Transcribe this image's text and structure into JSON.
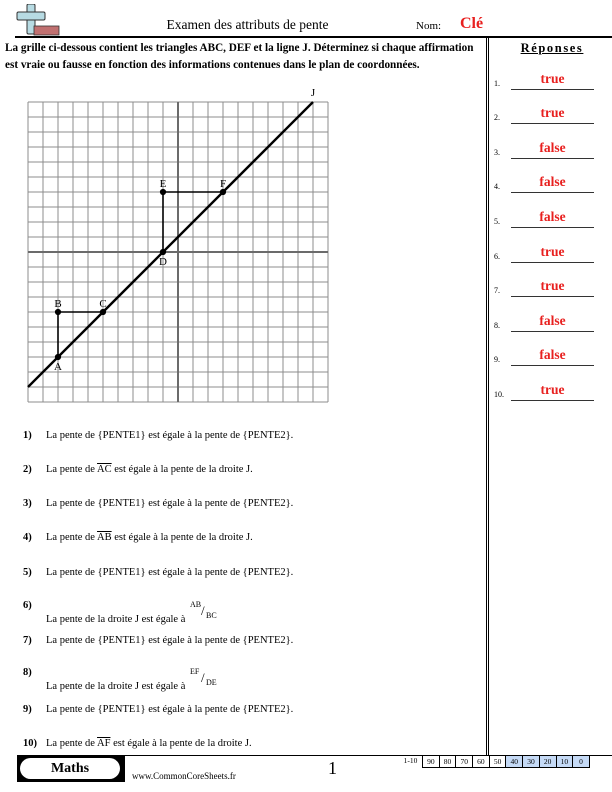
{
  "header": {
    "title": "Examen des attributs de pente",
    "name_label": "Nom:",
    "name_value": "Clé",
    "logo_icon": "plus-minus-logo-icon"
  },
  "instructions": "La grille ci-dessous contient les triangles ABC, DEF et la ligne J. Déterminez si chaque affirmation est vraie ou fausse en fonction des informations contenues dans le plan de coordonnées.",
  "graph": {
    "x_range": [
      -10,
      10
    ],
    "y_range": [
      -10,
      10
    ],
    "grid_step": 1,
    "points": [
      {
        "label": "A",
        "x": -8,
        "y": -7,
        "label_pos": "below"
      },
      {
        "label": "B",
        "x": -8,
        "y": -4,
        "label_pos": "above"
      },
      {
        "label": "C",
        "x": -5,
        "y": -4,
        "label_pos": "above"
      },
      {
        "label": "D",
        "x": -1,
        "y": 0,
        "label_pos": "below"
      },
      {
        "label": "E",
        "x": -1,
        "y": 4,
        "label_pos": "above"
      },
      {
        "label": "F",
        "x": 3,
        "y": 4,
        "label_pos": "above"
      }
    ],
    "segments": [
      [
        "A",
        "B"
      ],
      [
        "B",
        "C"
      ],
      [
        "D",
        "E"
      ],
      [
        "E",
        "F"
      ]
    ],
    "line_j": {
      "label": "J",
      "from": [
        -10,
        -9
      ],
      "to": [
        9,
        10
      ]
    }
  },
  "answers": {
    "title": "Réponses",
    "items": [
      {
        "num": "1.",
        "value": "true"
      },
      {
        "num": "2.",
        "value": "true"
      },
      {
        "num": "3.",
        "value": "false"
      },
      {
        "num": "4.",
        "value": "false"
      },
      {
        "num": "5.",
        "value": "false"
      },
      {
        "num": "6.",
        "value": "true"
      },
      {
        "num": "7.",
        "value": "true"
      },
      {
        "num": "8.",
        "value": "false"
      },
      {
        "num": "9.",
        "value": "false"
      },
      {
        "num": "10.",
        "value": "true"
      }
    ]
  },
  "questions": [
    {
      "num": "1)",
      "pre": "La pente de {PENTE1} est égale à la pente de {PENTE2}."
    },
    {
      "num": "2)",
      "pre": "La pente de ",
      "seg": "AC",
      "post": " est égale à la pente de la droite J."
    },
    {
      "num": "3)",
      "pre": "La pente de {PENTE1} est égale à la pente de {PENTE2}."
    },
    {
      "num": "4)",
      "pre": "La pente de ",
      "seg": "AB",
      "post": " est égale à la pente de la droite J."
    },
    {
      "num": "5)",
      "pre": "La pente de {PENTE1} est égale à la pente de {PENTE2}."
    },
    {
      "num": "6)",
      "pre": "La pente de la droite J est égale à ",
      "frac_num": "AB",
      "frac_den": "BC"
    },
    {
      "num": "7)",
      "pre": "La pente de {PENTE1} est égale à la pente de {PENTE2}."
    },
    {
      "num": "8)",
      "pre": "La pente de la droite J est égale à ",
      "frac_num": "EF",
      "frac_den": "DE"
    },
    {
      "num": "9)",
      "pre": "La pente de {PENTE1} est égale à la pente de {PENTE2}."
    },
    {
      "num": "10)",
      "pre": "La pente de ",
      "seg": "AF",
      "post": " est égale à la pente de la droite J."
    }
  ],
  "footer": {
    "subject": "Maths",
    "site": "www.CommonCoreSheets.fr",
    "page": "1",
    "score_label": "1-10",
    "scores": [
      {
        "v": "90",
        "hl": false
      },
      {
        "v": "80",
        "hl": false
      },
      {
        "v": "70",
        "hl": false
      },
      {
        "v": "60",
        "hl": false
      },
      {
        "v": "50",
        "hl": false
      },
      {
        "v": "40",
        "hl": true
      },
      {
        "v": "30",
        "hl": true
      },
      {
        "v": "20",
        "hl": true
      },
      {
        "v": "10",
        "hl": true
      },
      {
        "v": "0",
        "hl": true
      }
    ]
  },
  "colors": {
    "key_red": "#e8201f",
    "score_highlight": "#c5daf6",
    "logo_plus": "#b7dbe3",
    "logo_minus": "#c07070"
  }
}
